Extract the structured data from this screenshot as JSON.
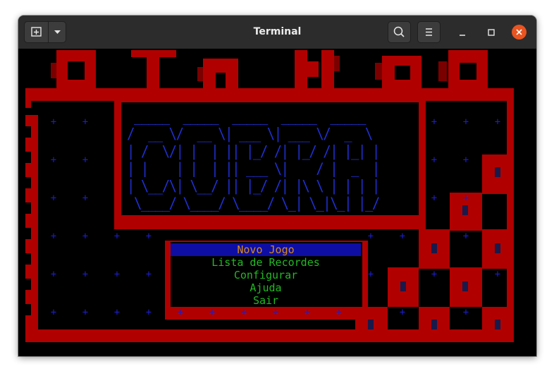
{
  "window": {
    "title": "Terminal",
    "new_tab_icon": "new-tab-icon",
    "dropdown_icon": "chevron-down-icon",
    "search_icon": "search-icon",
    "menu_icon": "hamburger-menu-icon",
    "minimize_icon": "minimize-icon",
    "maximize_icon": "maximize-icon",
    "close_icon": "close-icon",
    "close_color": "#e95420"
  },
  "game": {
    "logo_art": [
      " _____  _____  _____  _____  _____ ",
      "/  __ \\/  __ \\| ___ \\| ___ \\/  _  \\",
      "| /  \\/| |  | || |_/ /| |_/ /| |_| |",
      "| |    | |  | || ___ \\|    / |  _  |",
      "| \\__/\\| \\__/ || |_/ /| |\\ \\ | | | |",
      " \\____/ \\____/ \\____/ \\_| \\_|\\_| |_/"
    ],
    "menu": [
      {
        "label": "Novo Jogo",
        "selected": true
      },
      {
        "label": "Lista de Recordes",
        "selected": false
      },
      {
        "label": "Configurar",
        "selected": false
      },
      {
        "label": "Ajuda",
        "selected": false
      },
      {
        "label": "Sair",
        "selected": false
      }
    ],
    "plus_glyph": "+",
    "colors": {
      "wall": "#b00000",
      "grid": "#1d1dcc",
      "menu_text": "#22b922",
      "selected_bg": "#0e0ea5",
      "selected_text": "#d68a1a"
    }
  }
}
